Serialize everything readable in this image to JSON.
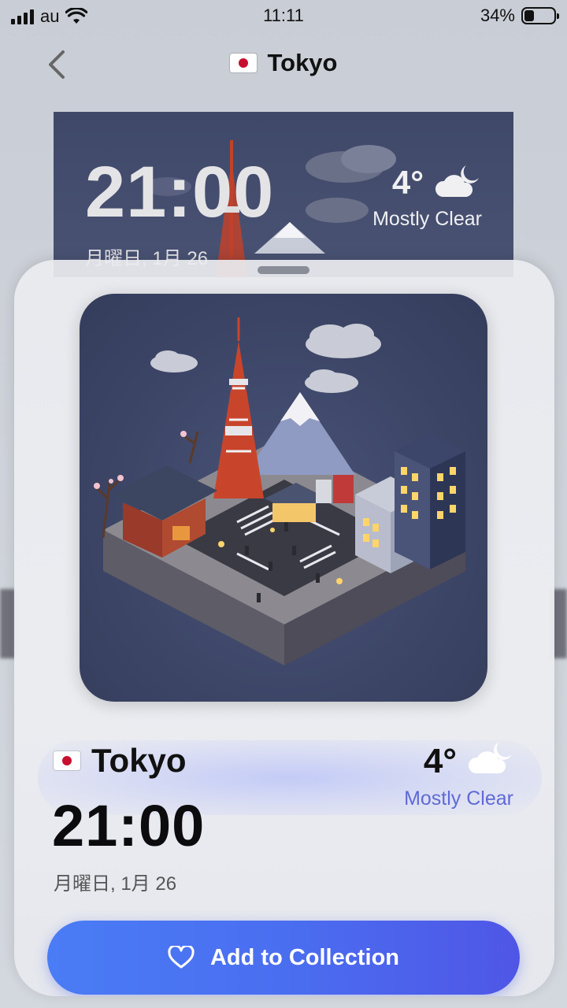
{
  "status_bar": {
    "carrier": "au",
    "time": "11:11",
    "battery": "34%",
    "battery_level": 0.34
  },
  "nav": {
    "title": "Tokyo",
    "flag": "japan-flag-icon",
    "back_icon": "chevron-left-icon"
  },
  "preview_widget": {
    "time": "21:00",
    "date": "月曜日, 1月 26",
    "temperature": "4°",
    "condition": "Mostly Clear",
    "weather_icon": "cloud-moon-icon"
  },
  "detail": {
    "city": "Tokyo",
    "time": "21:00",
    "date": "月曜日, 1月 26",
    "temperature": "4°",
    "condition": "Mostly Clear",
    "weather_icon": "cloud-moon-icon",
    "image": "isometric-tokyo-scene"
  },
  "cta": {
    "label": "Add to Collection",
    "icon": "heart-icon"
  },
  "colors": {
    "accent_blue": "#4a6ef0",
    "condition_text": "#5f6ad6",
    "widget_bg": "#434c6c"
  }
}
